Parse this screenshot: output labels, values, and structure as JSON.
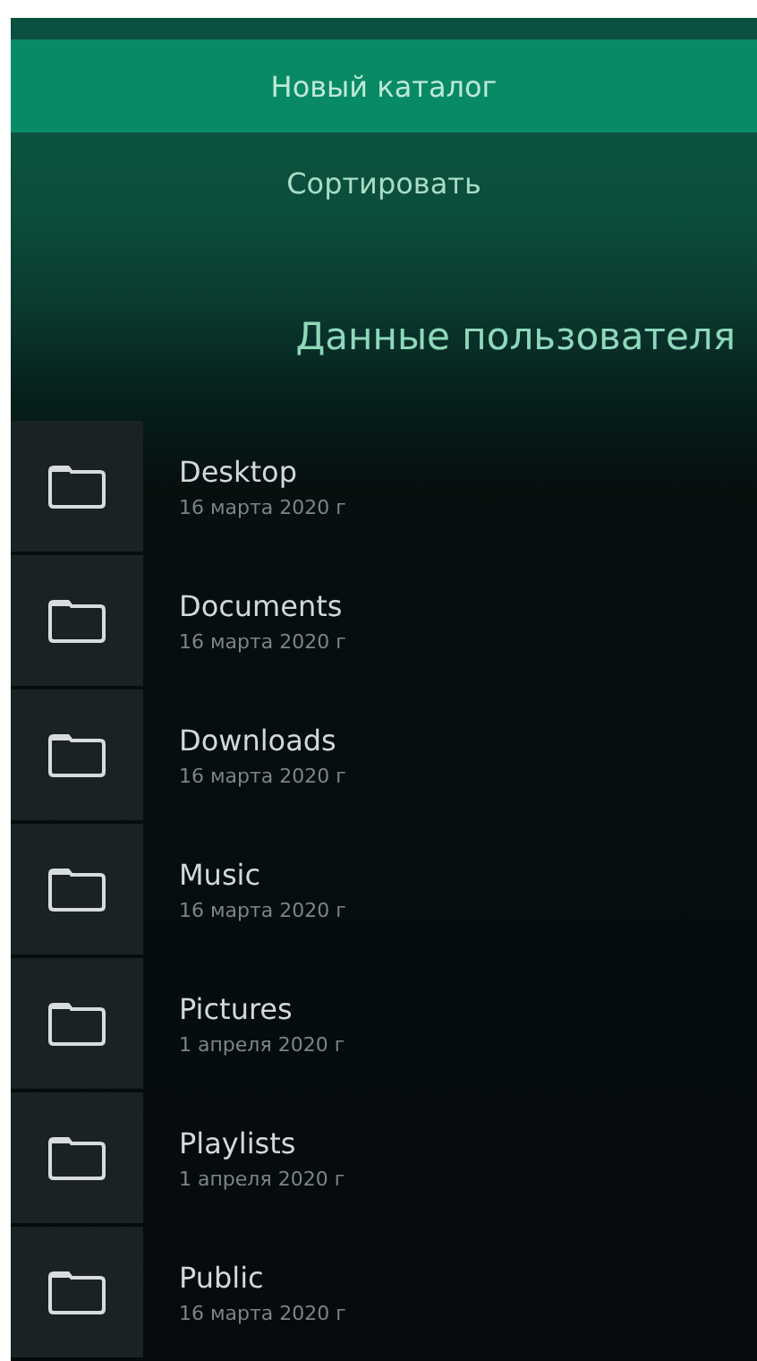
{
  "menu": [
    {
      "label": "Новый каталог",
      "selected": true
    },
    {
      "label": "Сортировать",
      "selected": false
    }
  ],
  "header": {
    "title": "Данные пользователя"
  },
  "files": [
    {
      "name": "Desktop",
      "date": "16 марта 2020 г"
    },
    {
      "name": "Documents",
      "date": "16 марта 2020 г"
    },
    {
      "name": "Downloads",
      "date": "16 марта 2020 г"
    },
    {
      "name": "Music",
      "date": "16 марта 2020 г"
    },
    {
      "name": "Pictures",
      "date": "1 апреля 2020 г"
    },
    {
      "name": "Playlists",
      "date": "1 апреля 2020 г"
    },
    {
      "name": "Public",
      "date": "16 марта 2020 г"
    }
  ]
}
